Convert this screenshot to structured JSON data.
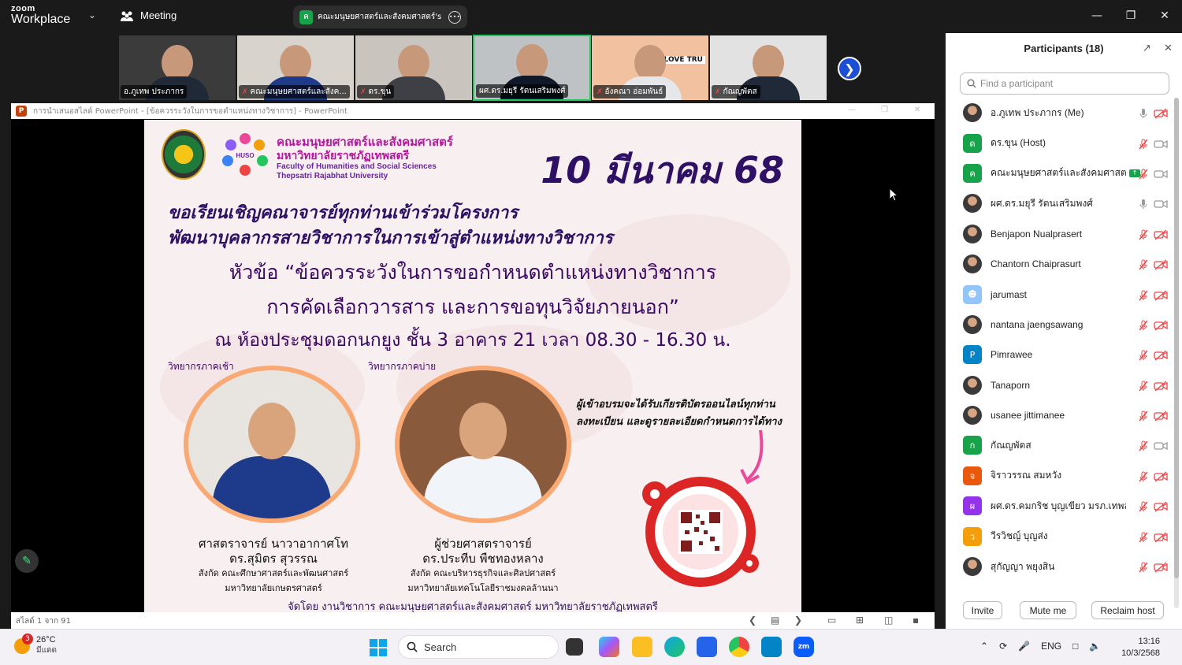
{
  "app": {
    "logo_top": "zoom",
    "logo_bottom": "Workplace",
    "meeting_label": "Meeting",
    "share_label": "คณะมนุษยศาสตร์และสังคมศาสตร์'s sc",
    "share_avatar": "ค"
  },
  "video_tiles": [
    {
      "name": "อ.ภูเทพ ประภากร",
      "muted": false,
      "active": false,
      "shirt": "#1f2937"
    },
    {
      "name": "คณะมนุษยศาสตร์และสังค...",
      "muted": true,
      "active": false,
      "shirt": "#1e3a8a"
    },
    {
      "name": "ดร.ขุน",
      "muted": true,
      "active": false,
      "shirt": "#3f3f46"
    },
    {
      "name": "ผศ.ดร.มยุรี รัตนเสริมพงศ์",
      "muted": false,
      "active": true,
      "shirt": "#111827"
    },
    {
      "name": "อังคณา อ่อมพันธ์",
      "muted": true,
      "active": false,
      "shirt": "#e5e7eb"
    },
    {
      "name": "กัณญพัตส",
      "muted": true,
      "active": false,
      "shirt": "#1f2937"
    }
  ],
  "tile_banner_text": "I LOVE TRU",
  "ppt": {
    "title": "การนำเสนอสไลด์ PowerPoint - [ข้อควรระวังในการขอตำแหน่งทางวิชาการ] - PowerPoint",
    "status": "สไลด์ 1 จาก 91"
  },
  "slide": {
    "faculty_th_1": "คณะมนุษยศาสตร์และสังคมศาสตร์",
    "faculty_th_2": "มหาวิทยาลัยราชภัฏเทพสตรี",
    "faculty_en_1": "Faculty of Humanities and Social Sciences",
    "faculty_en_2": "Thepsatri Rajabhat University",
    "logo_text": "HUSO",
    "date": "10 มีนาคม 68",
    "invite_1": "ขอเรียนเชิญคณาจารย์ทุกท่านเข้าร่วมโครงการ",
    "invite_2": "พัฒนาบุคลากรสายวิชาการในการเข้าสู่ตำแหน่งทางวิชาการ",
    "topic_1": "หัวข้อ “ข้อควรระวังในการขอกำหนดตำแหน่งทางวิชาการ",
    "topic_2": "การคัดเลือกวารสาร และการขอทุนวิจัยภายนอก”",
    "venue": "ณ ห้องประชุมดอกนกยูง ชั้น 3 อาคาร 21 เวลา 08.30 - 16.30 น.",
    "morning_label": "วิทยากรภาคเช้า",
    "afternoon_label": "วิทยากรภาคบ่าย",
    "speaker1_title": "ศาสตราจารย์ นาวาอากาศโท",
    "speaker1_name": "ดร.สุมิตร สุวรรณ",
    "speaker1_aff1": "สังกัด คณะศึกษาศาสตร์และพัฒนศาสตร์",
    "speaker1_aff2": "มหาวิทยาลัยเกษตรศาสตร์",
    "speaker2_title": "ผู้ช่วยศาสตราจารย์",
    "speaker2_name": "ดร.ประทีบ พืชทองหลาง",
    "speaker2_aff1": "สังกัด คณะบริหารธุรกิจและศิลปศาสตร์",
    "speaker2_aff2": "มหาวิทยาลัยเทคโนโลยีราชมงคลล้านนา",
    "cert_note_1": "ผู้เข้าอบรมจะได้รับเกียรติบัตรออนไลน์ทุกท่าน",
    "cert_note_2": "ลงทะเบียน และดูรายละเอียดกำหนดการได้ทาง",
    "organizer": "จัดโดย งานวิชาการ คณะมนุษยศาสตร์และสังคมศาสตร์ มหาวิทยาลัยราชภัฏเทพสตรี"
  },
  "panel": {
    "title": "Participants (18)",
    "search_placeholder": "Find a participant",
    "participants": [
      {
        "name": "อ.ภูเทพ ประภากร (Me)",
        "avatar": "photo",
        "mic": "on",
        "cam": "off"
      },
      {
        "name": "ดร.ขุน (Host)",
        "avatar": "ด",
        "color": "#16a34a",
        "mic": "off",
        "cam": "on"
      },
      {
        "name": "คณะมนุษยศาสตร์และสังคมศาสตร์",
        "avatar": "ค",
        "color": "#16a34a",
        "mic": "off",
        "cam": "on",
        "sharing": true
      },
      {
        "name": "ผศ.ดร.มยุรี รัตนเสริมพงศ์",
        "avatar": "photo",
        "mic": "on",
        "cam": "on"
      },
      {
        "name": "Benjapon Nualprasert",
        "avatar": "photo",
        "mic": "off",
        "cam": "off"
      },
      {
        "name": "Chantorn Chaiprasurt",
        "avatar": "photo",
        "mic": "off",
        "cam": "off"
      },
      {
        "name": "jarumast",
        "avatar": "person",
        "color": "#93c5fd",
        "mic": "off",
        "cam": "off"
      },
      {
        "name": "nantana jaengsawang",
        "avatar": "photo",
        "mic": "off",
        "cam": "off"
      },
      {
        "name": "Pimrawee",
        "avatar": "P",
        "color": "#0284c7",
        "mic": "off",
        "cam": "off"
      },
      {
        "name": "Tanaporn",
        "avatar": "photo",
        "mic": "off",
        "cam": "off"
      },
      {
        "name": "usanee jittimanee",
        "avatar": "photo",
        "mic": "off",
        "cam": "off"
      },
      {
        "name": "กัณญพัตส",
        "avatar": "ก",
        "color": "#16a34a",
        "mic": "off",
        "cam": "on"
      },
      {
        "name": "จิราวรรณ สมหวัง",
        "avatar": "จ",
        "color": "#ea580c",
        "mic": "off",
        "cam": "off"
      },
      {
        "name": "ผศ.ดร.คมกริช บุญเขียว มรภ.เทพสตรี",
        "avatar": "ผ",
        "color": "#9333ea",
        "mic": "off",
        "cam": "off"
      },
      {
        "name": "วีรวิชญ์ บุญส่ง",
        "avatar": "ว",
        "color": "#f59e0b",
        "mic": "off",
        "cam": "off"
      },
      {
        "name": "สุกัญญา พยุงสิน",
        "avatar": "photo",
        "mic": "off",
        "cam": "off"
      }
    ],
    "invite_label": "Invite",
    "mute_label": "Mute me",
    "reclaim_label": "Reclaim host"
  },
  "taskbar": {
    "weather_badge": "3",
    "temp": "26°C",
    "weather_desc": "มีแดด",
    "search": "Search",
    "lang": "ENG",
    "time": "13:16",
    "date": "10/3/2568"
  },
  "colors": {
    "zoom_blue": "#0b5cff",
    "muted_red": "#ef4444",
    "share_green": "#16a34a",
    "slide_purple": "#2e1065"
  }
}
